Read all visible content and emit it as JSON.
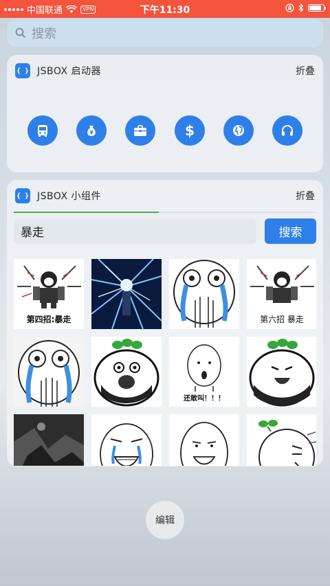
{
  "status_bar": {
    "carrier": "中国联通",
    "vpn": "VPN",
    "time": "下午11:30",
    "battery_level": 0.85
  },
  "search": {
    "placeholder": "搜索",
    "icon": "search-icon"
  },
  "launcher_widget": {
    "app_icon": "{ }",
    "title": "JSBOX 启动器",
    "fold_label": "折叠",
    "shortcuts": [
      {
        "icon": "bus-icon"
      },
      {
        "icon": "money-bag-icon"
      },
      {
        "icon": "briefcase-icon"
      },
      {
        "icon": "dollar-icon"
      },
      {
        "icon": "globe-icon"
      },
      {
        "icon": "headphones-icon"
      }
    ],
    "accent_color": "#2f7fe8"
  },
  "mini_widget": {
    "app_icon": "{ }",
    "title": "JSBOX 小组件",
    "fold_label": "折叠",
    "progress": 0.48,
    "query": "暴走",
    "search_button": "搜索",
    "images": [
      {
        "kind": "rage-comic",
        "caption": "第四招:暴走"
      },
      {
        "kind": "anime-lightning",
        "caption": ""
      },
      {
        "kind": "crying-face",
        "caption": ""
      },
      {
        "kind": "rage-comic",
        "caption": "第六招  暴走"
      },
      {
        "kind": "crying-face",
        "caption": ""
      },
      {
        "kind": "radish-screaming",
        "caption": ""
      },
      {
        "kind": "shocked-face",
        "caption": "还敢叫！！！"
      },
      {
        "kind": "radish-laughing",
        "caption": ""
      },
      {
        "kind": "dark-scene",
        "caption": ""
      },
      {
        "kind": "crying-laugh",
        "caption": ""
      },
      {
        "kind": "grinning-face",
        "caption": ""
      },
      {
        "kind": "sprout-ball",
        "caption": ""
      }
    ]
  },
  "edit_button": "编辑"
}
